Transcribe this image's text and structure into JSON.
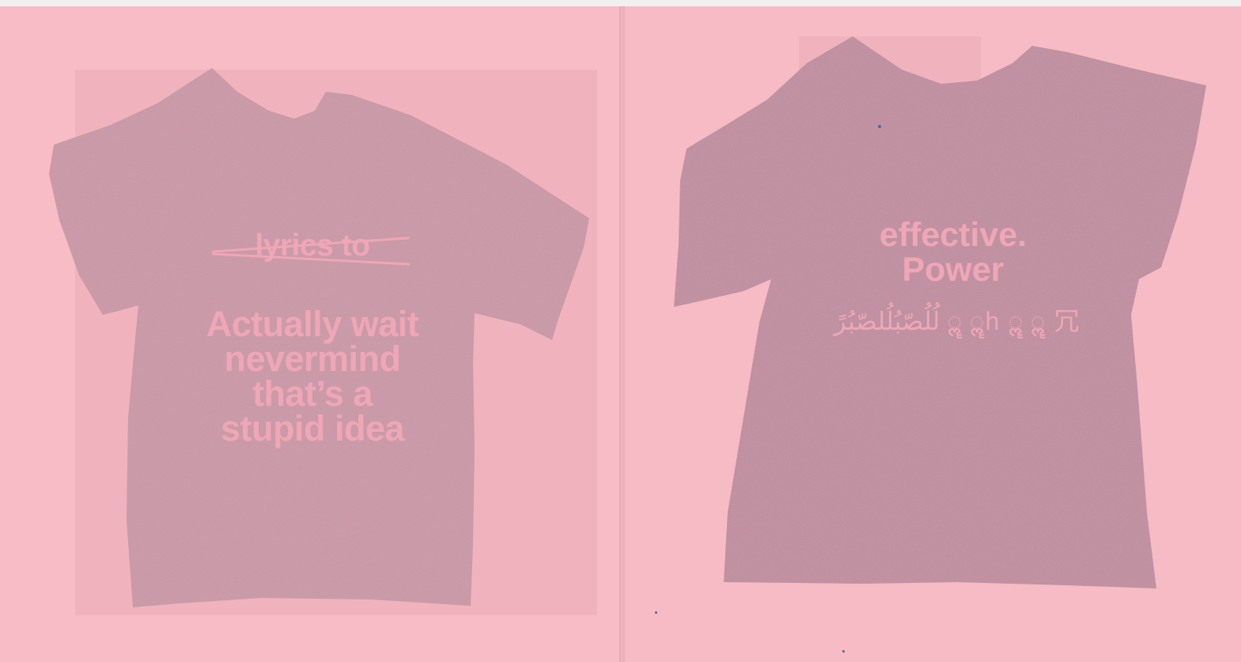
{
  "left_page": {
    "shirt": {
      "name": "t-shirt-left",
      "color": "#c8909f"
    },
    "struck_text": "lyrics to",
    "message_lines": [
      "Actually wait",
      "nevermind",
      "that’s a",
      "stupid idea"
    ]
  },
  "right_page": {
    "shirt": {
      "name": "t-shirt-right",
      "color": "#bd8597"
    },
    "heading_lines": [
      "effective.",
      "Power"
    ],
    "glyph_line": "لُلُصّبُلُلصّبُرً ॣॣ ॣॣh ॣॣ ॣॣ 冗"
  },
  "colors": {
    "paper": "#f7bcc5",
    "shirt_text": "#efa6b6"
  }
}
